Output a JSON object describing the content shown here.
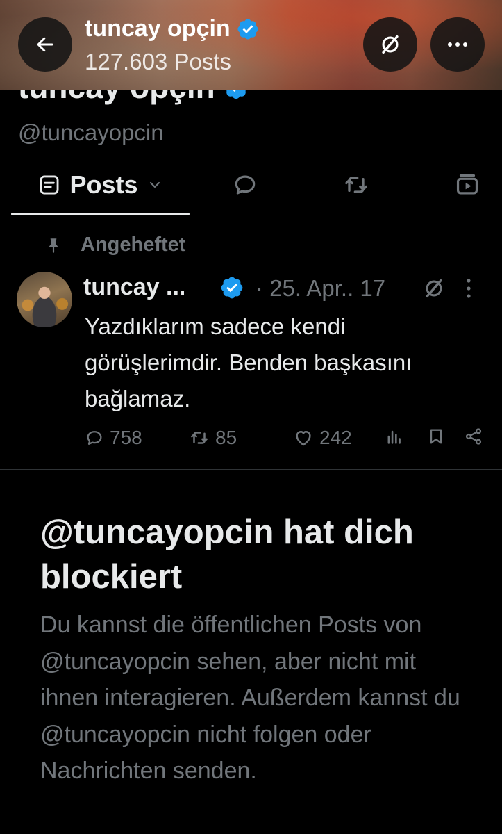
{
  "header": {
    "name": "tuncay opçin",
    "post_count": "127.603 Posts",
    "verified": true
  },
  "profile": {
    "name": "tuncay opçin",
    "handle": "@tuncayopcin"
  },
  "tabs": [
    {
      "label": "Posts",
      "active": true,
      "icon": "posts-icon"
    },
    {
      "label": "",
      "icon": "replies-icon"
    },
    {
      "label": "",
      "icon": "reposts-icon"
    },
    {
      "label": "",
      "icon": "media-icon"
    }
  ],
  "pinned_post": {
    "pinned_label": "Angeheftet",
    "author": "tuncay ...",
    "date": "· 25. Apr.. 17",
    "text": "Yazdıklarım sadece kendi görüşlerimdir. Benden başkasını bağlamaz.",
    "replies": "758",
    "reposts": "85",
    "likes": "242"
  },
  "blocked": {
    "title": "@tuncayopcin hat dich blockiert",
    "description": "Du kannst die öffentlichen Posts von @tuncayopcin sehen, aber nicht mit ihnen interagieren. Außerdem kannst du @tuncayopcin nicht folgen oder Nachrichten senden."
  },
  "colors": {
    "background": "#000000",
    "text": "#e7e9ea",
    "secondary_text": "#71767b",
    "verified_blue": "#1d9bf0",
    "divider": "#2f3336"
  }
}
